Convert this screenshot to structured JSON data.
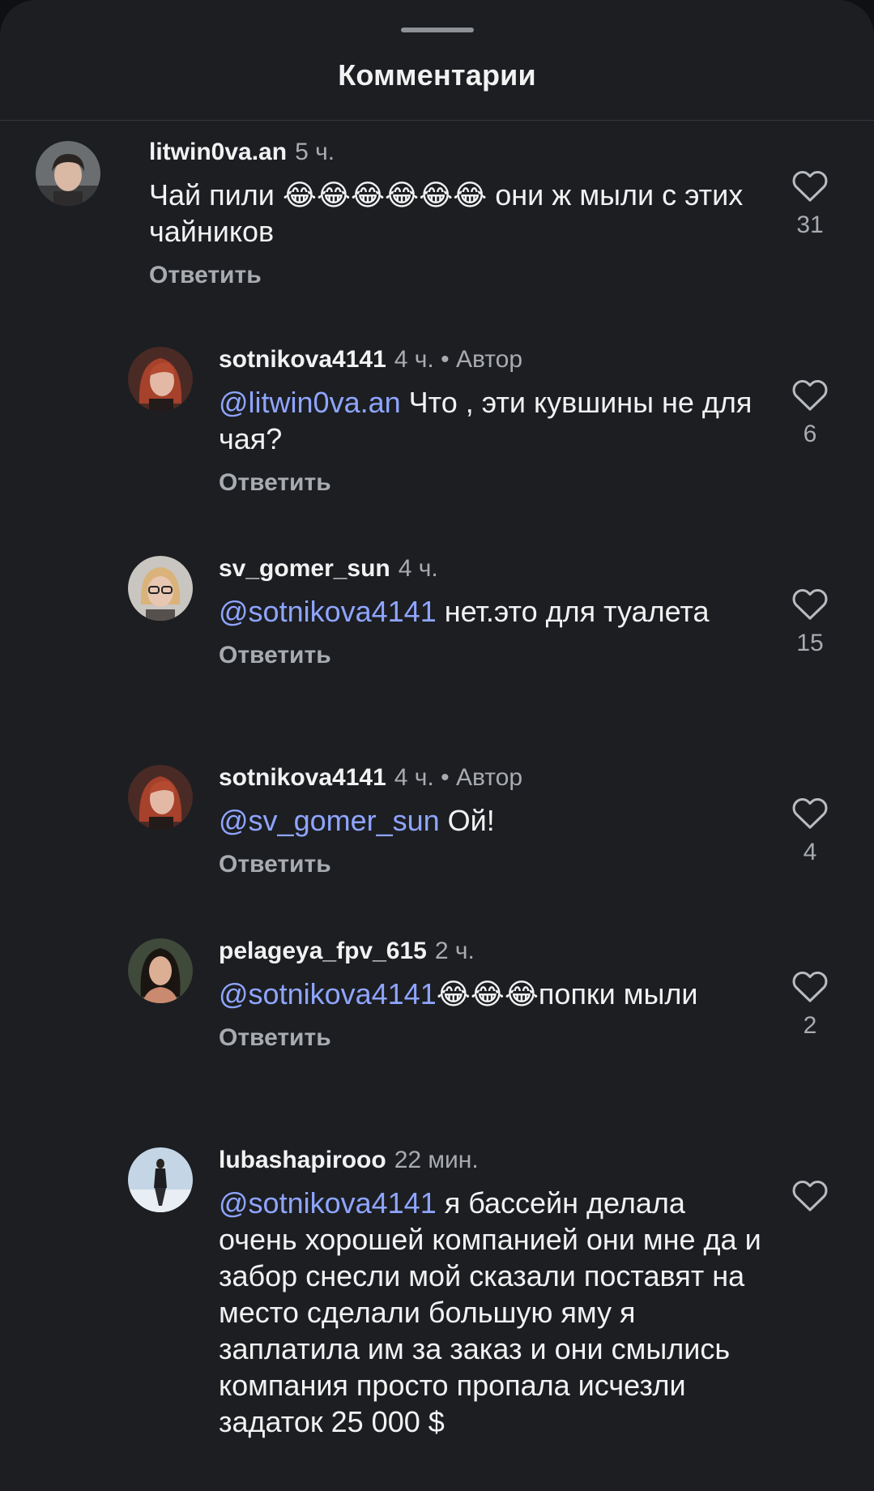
{
  "header": {
    "title": "Комментарии"
  },
  "author_label": "• Автор",
  "reply_label": "Ответить",
  "colors": {
    "background": "#1c1e22",
    "mention": "#8fa5ff",
    "muted": "#a8abb0",
    "text": "#f2f2f2"
  },
  "comments": [
    {
      "username": "litwin0va.an",
      "time": "5 ч.",
      "is_author": false,
      "text_before": "Чай пили ",
      "emoji": "😂😂😂😂😂😂",
      "text_after": " они ж мыли с этих чайников",
      "likes": "31",
      "avatar": "person-dark-hair-avatar"
    },
    {
      "username": "sotnikova4141",
      "time": "4 ч.",
      "is_author": true,
      "mention": "@litwin0va.an",
      "text": "  Что , эти кувшины не для чая?",
      "likes": "6",
      "avatar": "woman-red-hair-avatar"
    },
    {
      "username": "sv_gomer_sun",
      "time": "4 ч.",
      "is_author": false,
      "mention": "@sotnikova4141",
      "text": " нет.это для туалета",
      "likes": "15",
      "avatar": "woman-glasses-avatar"
    },
    {
      "username": "sotnikova4141",
      "time": "4 ч.",
      "is_author": true,
      "mention": "@sv_gomer_sun",
      "text": "  Ой!",
      "likes": "4",
      "avatar": "woman-red-hair-avatar"
    },
    {
      "username": "pelageya_fpv_615",
      "time": "2 ч.",
      "is_author": false,
      "mention": "@sotnikova4141",
      "emoji": "😂😂😂",
      "text": "попки мыли",
      "likes": "2",
      "avatar": "woman-dark-hair-avatar"
    },
    {
      "username": "lubashapirooo",
      "time": "22 мин.",
      "is_author": false,
      "mention": "@sotnikova4141",
      "text": " я бассейн делала очень хорошей компанией они мне да и забор снесли мой сказали поставят на место сделали большую яму я заплатила им за заказ и они смылись компания просто пропала исчезли задаток 25 000 $",
      "likes": "",
      "avatar": "person-full-figure-avatar"
    }
  ]
}
